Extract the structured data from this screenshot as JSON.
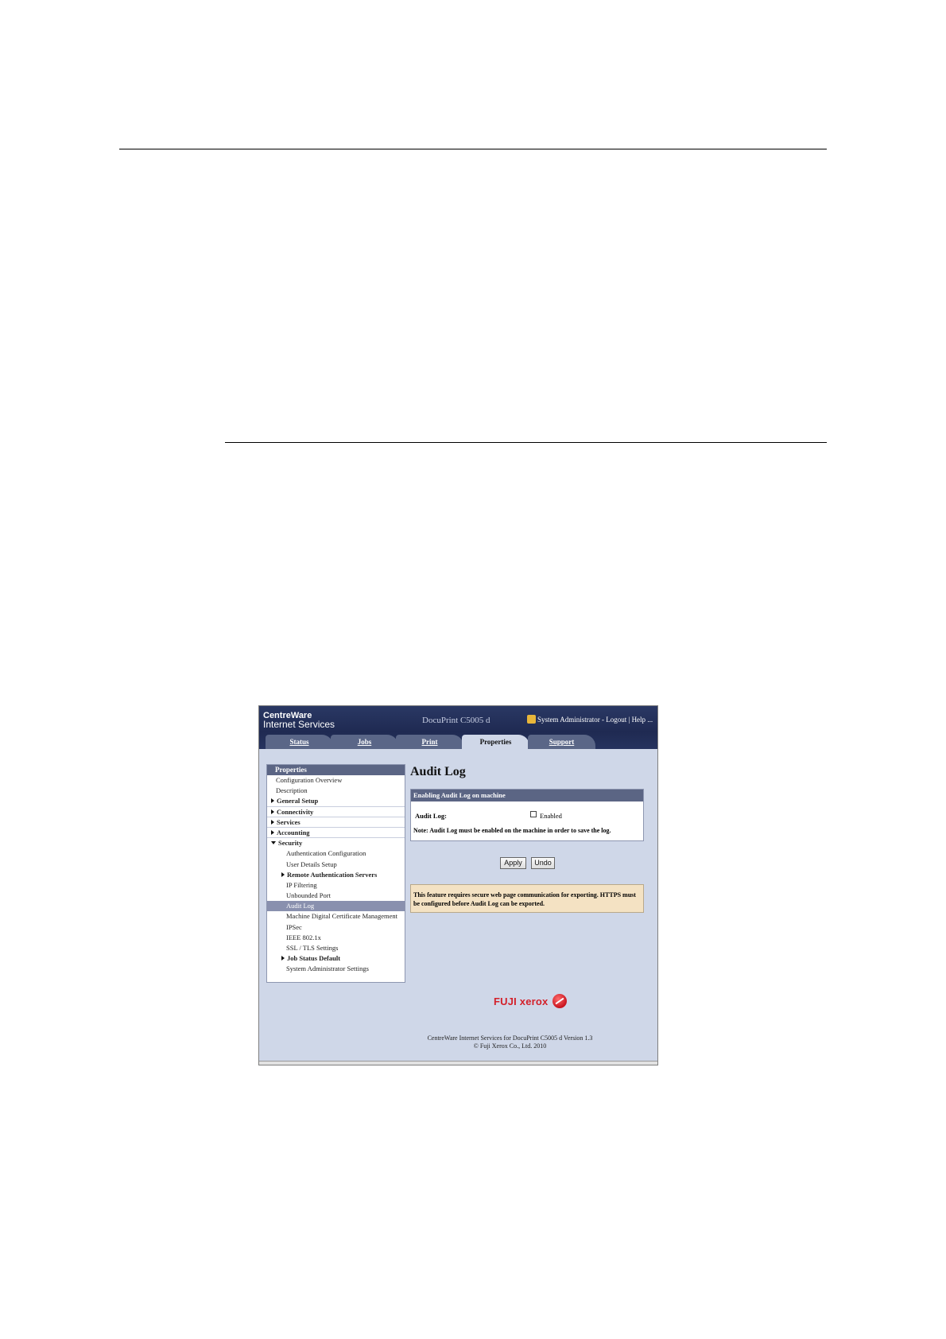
{
  "header": {
    "brand_line1": "CentreWare",
    "brand_line2": "Internet Services",
    "model": "DocuPrint C5005 d",
    "admin": "System Administrator",
    "logout": "Logout",
    "help": "Help"
  },
  "tabs": [
    {
      "label": "Status"
    },
    {
      "label": "Jobs"
    },
    {
      "label": "Print"
    },
    {
      "label": "Properties"
    },
    {
      "label": "Support"
    }
  ],
  "nav": {
    "title": "Properties",
    "items": [
      {
        "label": "Configuration Overview"
      },
      {
        "label": "Description"
      },
      {
        "label": "General Setup"
      },
      {
        "label": "Connectivity"
      },
      {
        "label": "Services"
      },
      {
        "label": "Accounting"
      },
      {
        "label": "Security"
      },
      {
        "label": "Authentication Configuration"
      },
      {
        "label": "User Details Setup"
      },
      {
        "label": "Remote Authentication Servers"
      },
      {
        "label": "IP Filtering"
      },
      {
        "label": "Unbounded Port"
      },
      {
        "label": "Audit Log"
      },
      {
        "label": "Machine Digital Certificate Management"
      },
      {
        "label": "IPSec"
      },
      {
        "label": "IEEE 802.1x"
      },
      {
        "label": "SSL / TLS Settings"
      },
      {
        "label": "Job Status Default"
      },
      {
        "label": "System Administrator Settings"
      }
    ]
  },
  "main": {
    "title": "Audit Log",
    "panel_title": "Enabling Audit Log on machine",
    "audit_log_label": "Audit Log:",
    "enabled_label": "Enabled",
    "note": "Note: Audit Log must be enabled on the machine in order to save the log.",
    "apply": "Apply",
    "undo": "Undo",
    "warning": "This feature requires secure web page communication for exporting. HTTPS must be configured before Audit Log can be exported."
  },
  "footer": {
    "logo": "FUJI xerox",
    "line1": "CentreWare Internet Services for DocuPrint C5005 d Version 1.3",
    "line2": "© Fuji Xerox Co., Ltd. 2010"
  }
}
